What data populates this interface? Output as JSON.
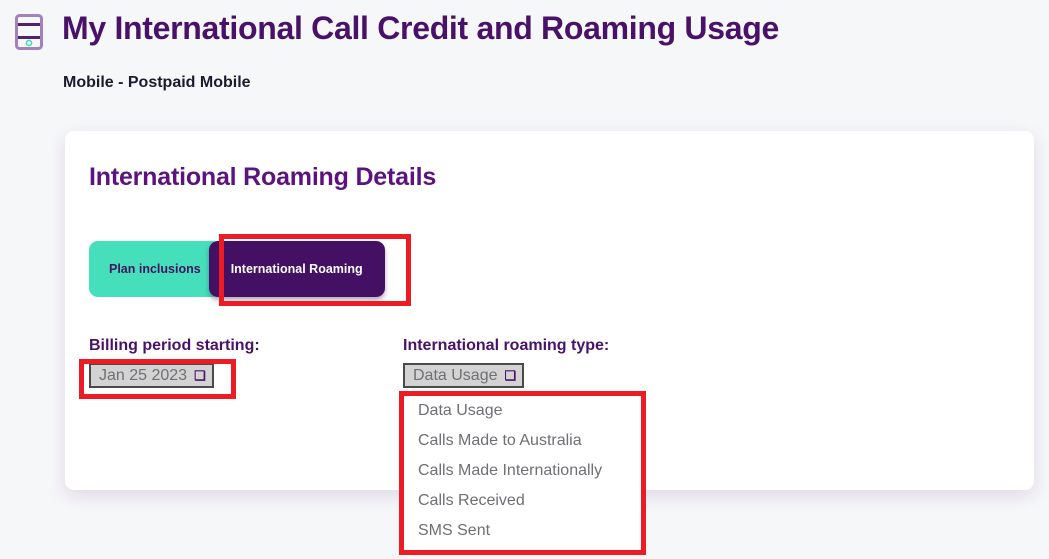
{
  "header": {
    "icon": "sim-card-icon",
    "title": "My International Call Credit and Roaming Usage",
    "subtitle": "Mobile - Postpaid Mobile"
  },
  "card": {
    "title": "International Roaming Details",
    "tabs": [
      {
        "label": "Plan inclusions",
        "selected": false
      },
      {
        "label": "International Roaming",
        "selected": true
      }
    ],
    "billing_period": {
      "label": "Billing period starting:",
      "value": "Jan 25 2023",
      "caret": "⌄"
    },
    "roaming_type": {
      "label": "International roaming type:",
      "value": "Data Usage",
      "caret": "⌄",
      "options": [
        "Data Usage",
        "Calls Made to Australia",
        "Calls Made Internationally",
        "Calls Received",
        "SMS Sent"
      ]
    }
  },
  "annotations": {
    "color": "#ed1c24",
    "boxes": [
      "international-roaming-tab",
      "billing-period-select",
      "roaming-type-options-list"
    ]
  },
  "colors": {
    "page_background": "#f6f7f9",
    "card_background": "#ffffff",
    "brand_purple": "#4a1168",
    "tab_active_purple": "#431063",
    "tab_inactive_teal": "#45dfbc",
    "select_grey": "#d3d3d3",
    "option_text_grey": "#6f6f74",
    "annotation_red": "#ed1c24"
  }
}
